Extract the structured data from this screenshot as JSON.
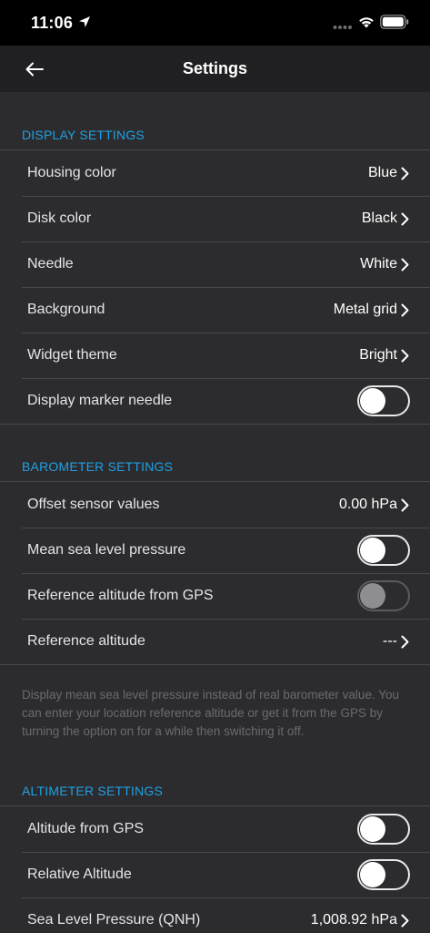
{
  "status_bar": {
    "time": "11:06"
  },
  "nav": {
    "title": "Settings"
  },
  "display_settings": {
    "header": "DISPLAY SETTINGS",
    "rows": [
      {
        "label": "Housing color",
        "value": "Blue"
      },
      {
        "label": "Disk color",
        "value": "Black"
      },
      {
        "label": "Needle",
        "value": "White"
      },
      {
        "label": "Background",
        "value": "Metal grid"
      },
      {
        "label": "Widget theme",
        "value": "Bright"
      },
      {
        "label": "Display marker needle",
        "toggle": "off"
      }
    ]
  },
  "barometer_settings": {
    "header": "BAROMETER SETTINGS",
    "rows": [
      {
        "label": "Offset sensor values",
        "value": "0.00 hPa"
      },
      {
        "label": "Mean sea level pressure",
        "toggle": "off"
      },
      {
        "label": "Reference altitude from GPS",
        "toggle": "off-disabled"
      },
      {
        "label": "Reference altitude",
        "value": "---"
      }
    ],
    "footnote": "Display mean sea level pressure instead of real barometer value. You can enter your location reference altitude or get it from the GPS by turning the option on for a while then switching it off."
  },
  "altimeter_settings": {
    "header": "ALTIMETER SETTINGS",
    "rows": [
      {
        "label": "Altitude from GPS",
        "toggle": "off"
      },
      {
        "label": "Relative Altitude",
        "toggle": "off"
      },
      {
        "label": "Sea Level Pressure (QNH)",
        "value": "1,008.92 hPa"
      }
    ]
  },
  "colors": {
    "accent": "#1ea0e6",
    "background": "#2c2c2e",
    "nav_background": "#202022",
    "separator": "#48484a"
  },
  "icons": {
    "back": "arrow-left-icon",
    "chevron": "chevron-right-icon",
    "location": "location-arrow-icon",
    "wifi": "wifi-icon",
    "battery": "battery-icon"
  }
}
